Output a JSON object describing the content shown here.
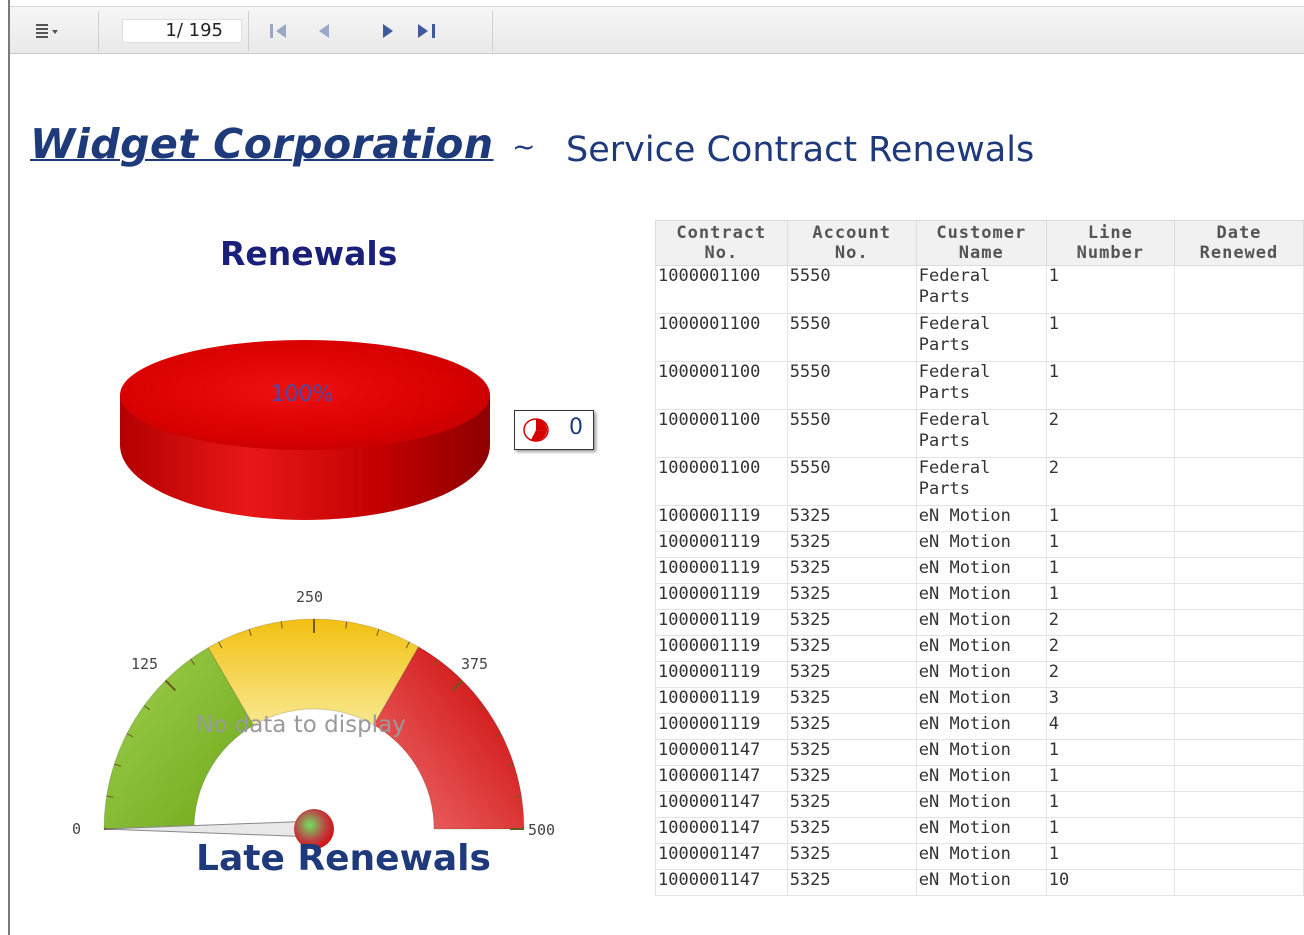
{
  "toolbar": {
    "menu_icon": "list-menu-icon",
    "page_indicator": "1/ 195",
    "nav_first": "first-page-icon",
    "nav_prev": "prev-page-icon",
    "nav_next": "next-page-icon",
    "nav_last": "last-page-icon"
  },
  "report": {
    "company": "Widget Corporation",
    "separator": "~",
    "subtitle": "Service Contract Renewals"
  },
  "renewals_chart": {
    "title": "Renewals",
    "slice_label": "100%",
    "legend_value": "0",
    "legend_icon": "pie-legend-icon",
    "color": "#d40000"
  },
  "gauge": {
    "title": "Late Renewals",
    "no_data": "No data to display",
    "ticks": [
      "0",
      "125",
      "250",
      "375",
      "500"
    ],
    "bands": [
      {
        "from": 0,
        "to": 166,
        "color": "#7fb82a"
      },
      {
        "from": 166,
        "to": 333,
        "color": "#f0c020"
      },
      {
        "from": 333,
        "to": 500,
        "color": "#d81818"
      }
    ],
    "value": 0
  },
  "table": {
    "headers": [
      {
        "line1": "Contract",
        "line2": "No."
      },
      {
        "line1": "Account",
        "line2": "No."
      },
      {
        "line1": "Customer",
        "line2": "Name"
      },
      {
        "line1": "Line",
        "line2": "Number"
      },
      {
        "line1": "Date",
        "line2": "Renewed"
      }
    ],
    "rows": [
      [
        "1000001100",
        "5550",
        "Federal Parts",
        "1",
        ""
      ],
      [
        "1000001100",
        "5550",
        "Federal Parts",
        "1",
        ""
      ],
      [
        "1000001100",
        "5550",
        "Federal Parts",
        "1",
        ""
      ],
      [
        "1000001100",
        "5550",
        "Federal Parts",
        "2",
        ""
      ],
      [
        "1000001100",
        "5550",
        "Federal Parts",
        "2",
        ""
      ],
      [
        "1000001119",
        "5325",
        "eN Motion",
        "1",
        ""
      ],
      [
        "1000001119",
        "5325",
        "eN Motion",
        "1",
        ""
      ],
      [
        "1000001119",
        "5325",
        "eN Motion",
        "1",
        ""
      ],
      [
        "1000001119",
        "5325",
        "eN Motion",
        "1",
        ""
      ],
      [
        "1000001119",
        "5325",
        "eN Motion",
        "2",
        ""
      ],
      [
        "1000001119",
        "5325",
        "eN Motion",
        "2",
        ""
      ],
      [
        "1000001119",
        "5325",
        "eN Motion",
        "2",
        ""
      ],
      [
        "1000001119",
        "5325",
        "eN Motion",
        "3",
        ""
      ],
      [
        "1000001119",
        "5325",
        "eN Motion",
        "4",
        ""
      ],
      [
        "1000001147",
        "5325",
        "eN Motion",
        "1",
        ""
      ],
      [
        "1000001147",
        "5325",
        "eN Motion",
        "1",
        ""
      ],
      [
        "1000001147",
        "5325",
        "eN Motion",
        "1",
        ""
      ],
      [
        "1000001147",
        "5325",
        "eN Motion",
        "1",
        ""
      ],
      [
        "1000001147",
        "5325",
        "eN Motion",
        "1",
        ""
      ],
      [
        "1000001147",
        "5325",
        "eN Motion",
        "10",
        ""
      ]
    ]
  }
}
